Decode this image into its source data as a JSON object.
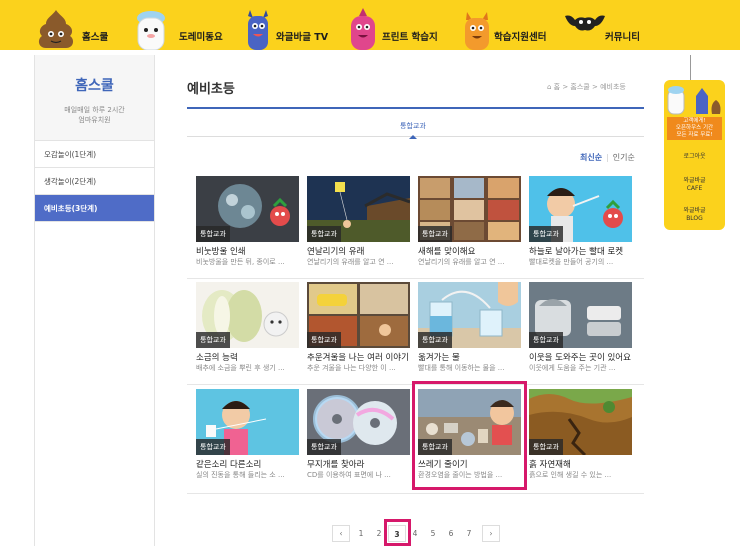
{
  "nav": {
    "items": [
      {
        "label": "홈스쿨",
        "icon": "poop-character-icon"
      },
      {
        "label": "도레미동요",
        "icon": "white-bear-character-icon"
      },
      {
        "label": "와글바글 TV",
        "icon": "blue-monster-character-icon"
      },
      {
        "label": "프린트 학습지",
        "icon": "pink-monster-character-icon"
      },
      {
        "label": "학습지원센터",
        "icon": "orange-cat-character-icon"
      },
      {
        "label": "커뮤니티",
        "icon": "bat-character-icon"
      }
    ]
  },
  "sidebar": {
    "title": "홈스쿨",
    "subtitle_1": "매일매일 하루 2시간",
    "subtitle_2": "엄마유치원",
    "items": [
      {
        "label": "오감놀이(1단계)"
      },
      {
        "label": "생각놀이(2단계)"
      },
      {
        "label": "예비초등(3단계)"
      }
    ]
  },
  "main": {
    "title": "예비초등",
    "breadcrumb": "홈 > 홈스쿨 > 예비초등",
    "tab": "통합교과",
    "sort": {
      "active": "최신순",
      "other": "인기순"
    },
    "cards": [
      {
        "badge": "통합교과",
        "title": "비눗방울 인쇄",
        "desc": "비눗방울을 만든 뒤, 종이로 ..."
      },
      {
        "badge": "통합교과",
        "title": "연날리기의 유래",
        "desc": "연날리기의 유래를 알고 연 ..."
      },
      {
        "badge": "통합교과",
        "title": "새해를 맞이해요",
        "desc": "연날리기의 유래를 알고 연 ..."
      },
      {
        "badge": "통합교과",
        "title": "하늘로 날아가는 빨대 로켓",
        "desc": "빨대로켓을 만들어 공기의 ..."
      },
      {
        "badge": "통합교과",
        "title": "소금의 능력",
        "desc": "배추에 소금을 뿌린 후 생기 ..."
      },
      {
        "badge": "통합교과",
        "title": "추운겨울을 나는 여러 이야기",
        "desc": "추운 겨울을 나는 다양한 이 ..."
      },
      {
        "badge": "통합교과",
        "title": "옮겨가는 물",
        "desc": "빨대를 통해 이동하는 물을 ..."
      },
      {
        "badge": "통합교과",
        "title": "이웃을 도와주는 곳이 있어요",
        "desc": "이웃에게 도움을 주는 기관 ..."
      },
      {
        "badge": "통합교과",
        "title": "같은소리 다른소리",
        "desc": "실의 진동을 통해 들리는 소 ..."
      },
      {
        "badge": "통합교과",
        "title": "무지개를 찾아라",
        "desc": "CD를 이용하여 표면에 나 ..."
      },
      {
        "badge": "통합교과",
        "title": "쓰레기 줄이기",
        "desc": "환경오염을 줄이는 방법을 ..."
      },
      {
        "badge": "통합교과",
        "title": "흙 자연재해",
        "desc": "흙으로 인해 생길 수 있는 ..."
      }
    ]
  },
  "pagination": {
    "prev": "‹",
    "next": "›",
    "pages": [
      "1",
      "2",
      "3",
      "4",
      "5",
      "6",
      "7"
    ],
    "current": "3"
  },
  "right_banner": {
    "notice_1": "고객에게!",
    "notice_2": "오픈하우스 기간",
    "notice_3": "모든 자료 무료!",
    "logout": "로그아웃",
    "cafe_1": "와글바글",
    "cafe_2": "CAFE",
    "blog_1": "와글바글",
    "blog_2": "BLOG"
  },
  "colors": {
    "nav_bg": "#fbd21c",
    "accent_blue": "#3f66b9",
    "active_side": "#4f6cc7",
    "highlight": "#d6186a"
  }
}
